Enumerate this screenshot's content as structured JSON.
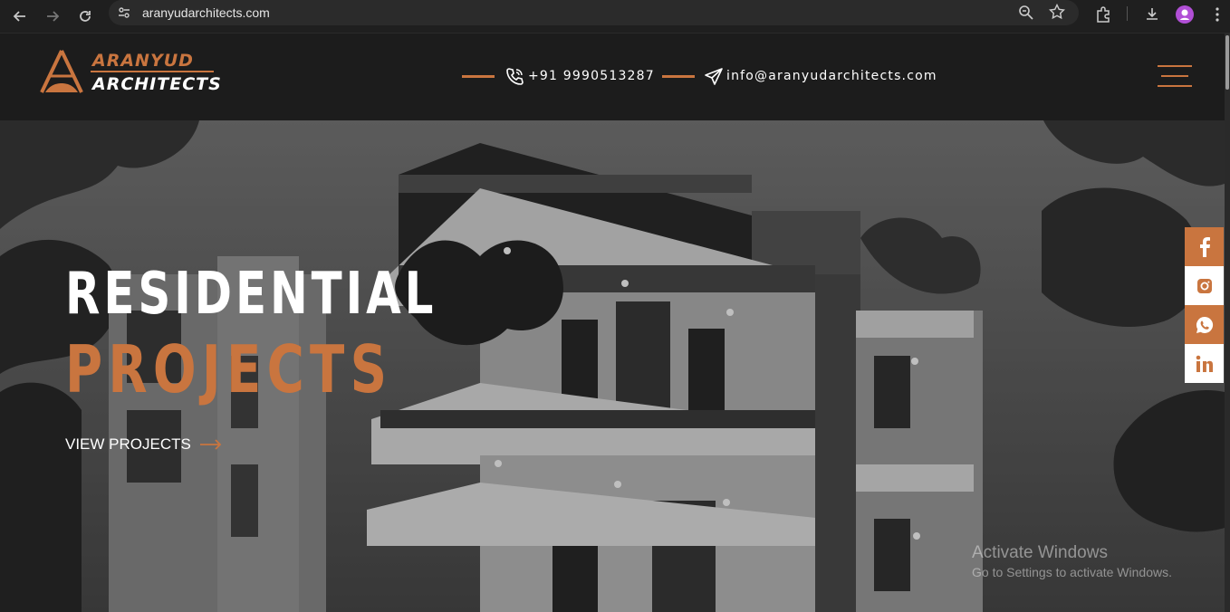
{
  "browser": {
    "url": "aranyudarchitects.com",
    "icons": [
      "back-arrow-icon",
      "forward-arrow-icon",
      "reload-icon",
      "site-info-icon",
      "zoom-icon",
      "star-icon",
      "extensions-icon",
      "download-icon",
      "profile-avatar-icon",
      "more-menu-icon"
    ]
  },
  "header": {
    "logo_line1": "ARANYUD",
    "logo_line2": "ARCHITECTS",
    "phone": "+91 9990513287",
    "email": "info@aranyudarchitects.com"
  },
  "hero": {
    "title_line1": "RESIDENTIAL",
    "title_line2": "PROJECTS",
    "cta_label": "VIEW PROJECTS"
  },
  "social": [
    "facebook-icon",
    "instagram-icon",
    "whatsapp-icon",
    "linkedin-icon"
  ],
  "watermark": {
    "line1": "Activate Windows",
    "line2": "Go to Settings to activate Windows."
  },
  "colors": {
    "accent": "#c9753f",
    "header_bg": "#1c1c1c",
    "chrome_bg": "#1f1f1f"
  }
}
